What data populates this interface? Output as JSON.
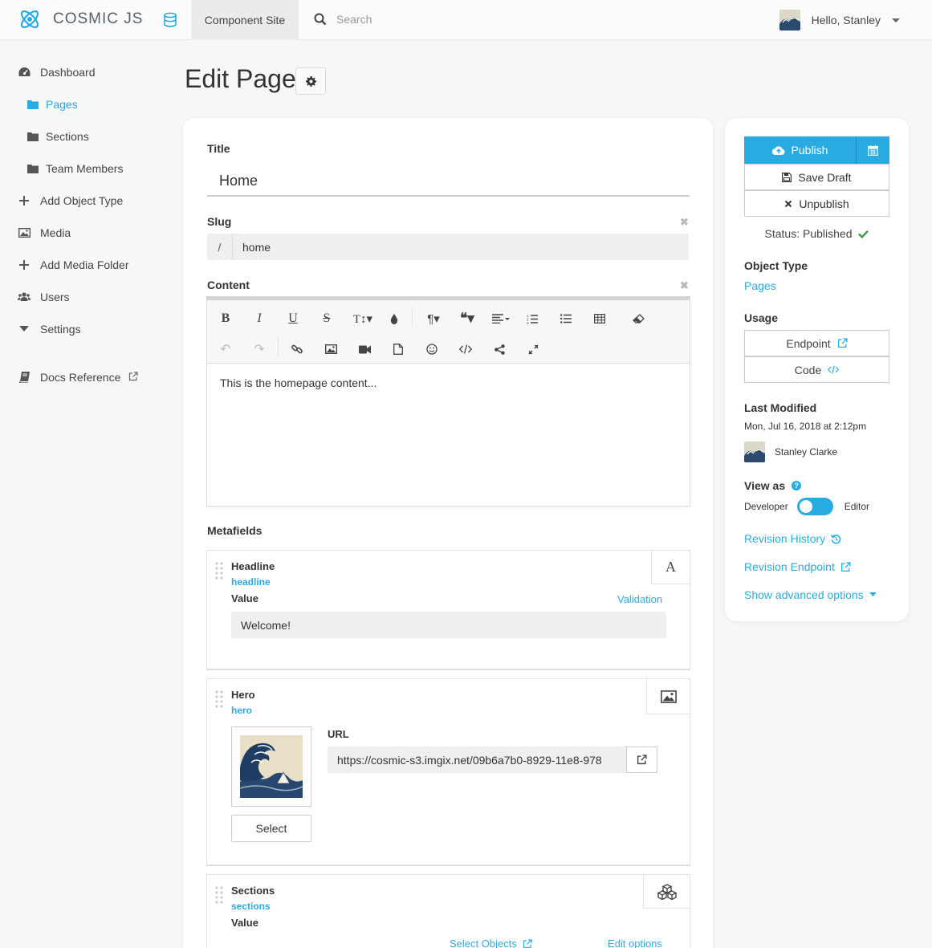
{
  "header": {
    "brand": "COSMIC JS",
    "bucket": "Component Site",
    "search_placeholder": "Search",
    "user_greeting": "Hello, Stanley"
  },
  "sidebar": {
    "items": [
      {
        "label": "Dashboard",
        "icon": "dashboard-icon"
      },
      {
        "label": "Pages",
        "icon": "folder-icon"
      },
      {
        "label": "Sections",
        "icon": "folder-icon"
      },
      {
        "label": "Team Members",
        "icon": "folder-icon"
      },
      {
        "label": "Add Object Type",
        "icon": "plus-icon"
      },
      {
        "label": "Media",
        "icon": "image-icon"
      },
      {
        "label": "Add Media Folder",
        "icon": "plus-icon"
      },
      {
        "label": "Users",
        "icon": "users-icon"
      },
      {
        "label": "Settings",
        "icon": "caret-down-icon"
      },
      {
        "label": "Docs Reference",
        "icon": "book-icon"
      }
    ]
  },
  "page": {
    "title": "Edit Page"
  },
  "form": {
    "title_label": "Title",
    "title_value": "Home",
    "slug_label": "Slug",
    "slug_prefix": "/",
    "slug_value": "home",
    "content_label": "Content",
    "content_value": "This is the homepage content...",
    "clear_symbol": "✖"
  },
  "metafields": {
    "label": "Metafields",
    "headline": {
      "name": "Headline",
      "key": "headline",
      "value_label": "Value",
      "validation": "Validation",
      "value": "Welcome!"
    },
    "hero": {
      "name": "Hero",
      "key": "hero",
      "url_label": "URL",
      "url": "https://cosmic-s3.imgix.net/09b6a7b0-8929-11e8-978",
      "select_label": "Select"
    },
    "sections": {
      "name": "Sections",
      "key": "sections",
      "value_label": "Value",
      "select_objects": "Select Objects",
      "edit_options": "Edit options"
    }
  },
  "publish": {
    "publish_label": "Publish",
    "save_draft": "Save Draft",
    "unpublish": "Unpublish",
    "status": "Status: Published",
    "object_type_label": "Object Type",
    "object_type_value": "Pages",
    "usage_label": "Usage",
    "endpoint": "Endpoint",
    "code": "Code",
    "last_modified_label": "Last Modified",
    "last_modified_date": "Mon, Jul 16, 2018 at 2:12pm",
    "modified_by": "Stanley Clarke",
    "view_as_label": "View as",
    "view_developer": "Developer",
    "view_editor": "Editor",
    "revision_history": "Revision History",
    "revision_endpoint": "Revision Endpoint",
    "advanced_options": "Show advanced options"
  },
  "colors": {
    "accent": "#29abe2",
    "success": "#3c9a3c"
  }
}
